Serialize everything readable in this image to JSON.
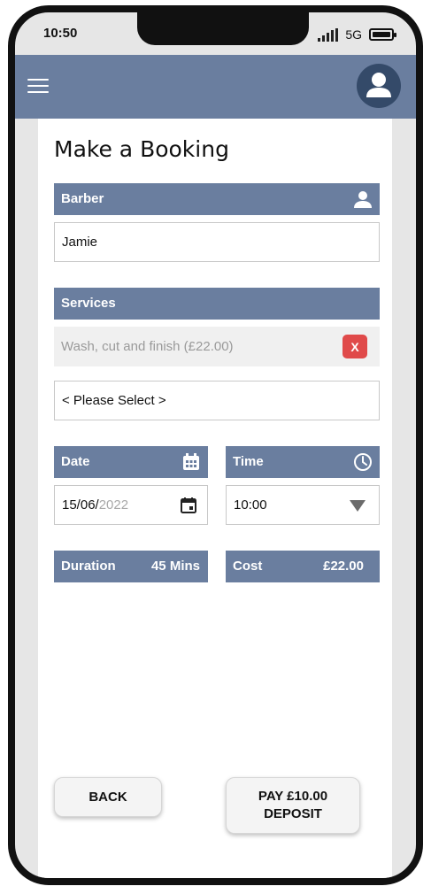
{
  "status_bar": {
    "time": "10:50",
    "network": "5G"
  },
  "app_bar": {
    "menu_icon": "hamburger-icon",
    "avatar_icon": "person-icon"
  },
  "page": {
    "title": "Make a Booking"
  },
  "barber": {
    "header": "Barber",
    "header_icon": "person-icon",
    "value": "Jamie"
  },
  "services": {
    "header": "Services",
    "selected": [
      {
        "label": "Wash, cut and finish (£22.00)",
        "remove_label": "X"
      }
    ],
    "select_placeholder": "< Please Select >"
  },
  "date": {
    "header": "Date",
    "header_icon": "calendar-icon",
    "value_main": "15/06/",
    "value_year": "2022",
    "picker_icon": "calendar-icon"
  },
  "time": {
    "header": "Time",
    "header_icon": "clock-icon",
    "value": "10:00"
  },
  "duration": {
    "label": "Duration",
    "value": "45 Mins"
  },
  "cost": {
    "label": "Cost",
    "value": "£22.00"
  },
  "actions": {
    "back_label": "BACK",
    "pay_line1": "PAY £10.00",
    "pay_line2": "DEPOSIT"
  },
  "colors": {
    "header_bg": "#6a7e9f",
    "avatar_bg": "#344a69",
    "remove_red": "#e04a4a"
  }
}
